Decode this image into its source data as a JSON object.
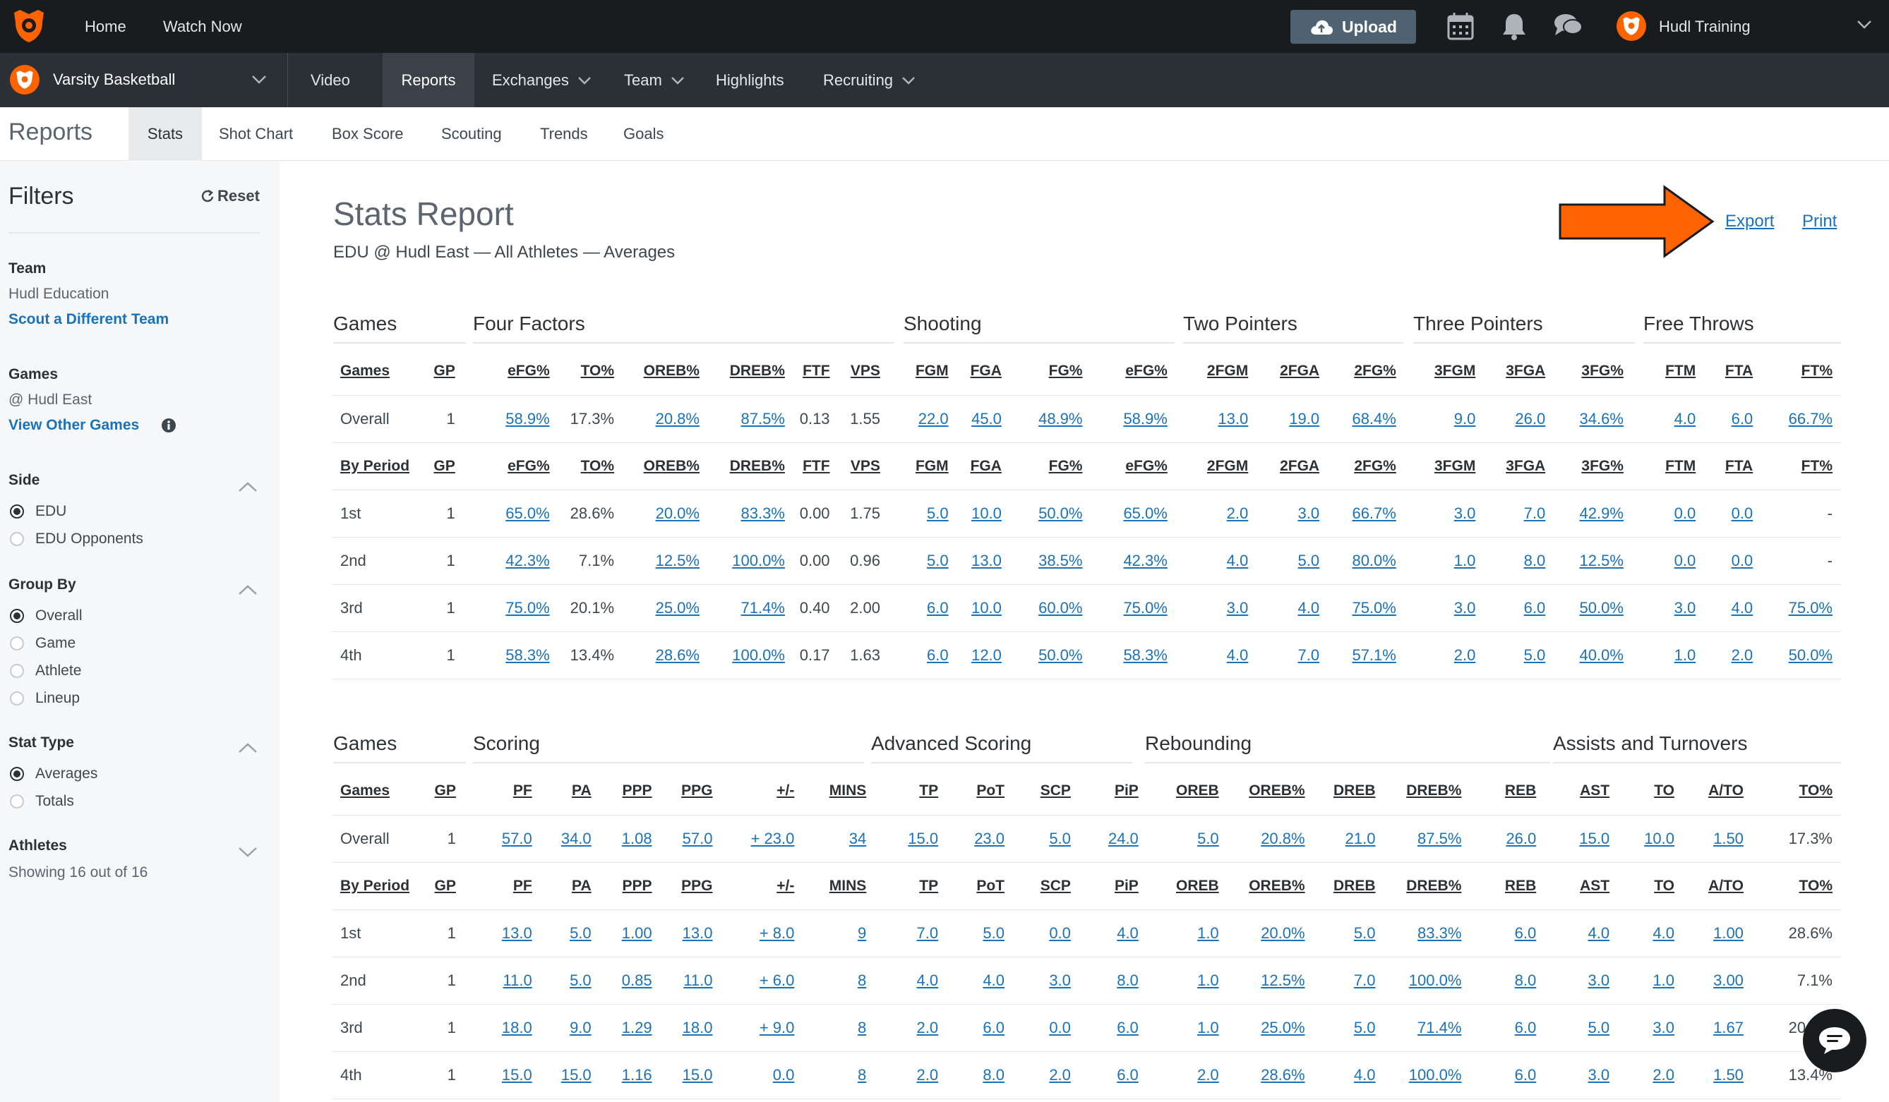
{
  "topbar": {
    "home": "Home",
    "watch_now": "Watch Now",
    "upload": "Upload",
    "user": "Hudl Training"
  },
  "navbar": {
    "team": "Varsity Basketball",
    "items": [
      "Video",
      "Reports",
      "Exchanges",
      "Team",
      "Highlights",
      "Recruiting"
    ]
  },
  "tabs": {
    "title": "Reports",
    "items": [
      "Stats",
      "Shot Chart",
      "Box Score",
      "Scouting",
      "Trends",
      "Goals"
    ]
  },
  "sidebar": {
    "title": "Filters",
    "reset": "Reset",
    "team_label": "Team",
    "team_value": "Hudl Education",
    "team_link": "Scout a Different Team",
    "games_label": "Games",
    "games_value": "@ Hudl East",
    "games_link": "View Other Games",
    "side_label": "Side",
    "side_options": [
      "EDU",
      "EDU Opponents"
    ],
    "groupby_label": "Group By",
    "groupby_options": [
      "Overall",
      "Game",
      "Athlete",
      "Lineup"
    ],
    "stattype_label": "Stat Type",
    "stattype_options": [
      "Averages",
      "Totals"
    ],
    "athletes_label": "Athletes",
    "athletes_value": "Showing 16 out of 16"
  },
  "report": {
    "title": "Stats Report",
    "subtitle": "EDU @ Hudl East — All Athletes — Averages",
    "export": "Export",
    "print": "Print"
  },
  "colors": {
    "accent": "#ff6300",
    "link": "#1b72b8",
    "topbar": "#191c1f"
  },
  "table1": {
    "groups": [
      "Games",
      "Four Factors",
      "Shooting",
      "Two Pointers",
      "Three Pointers",
      "Free Throws"
    ],
    "head_overall": [
      "Games",
      "GP",
      "eFG%",
      "TO%",
      "OREB%",
      "DREB%",
      "FTF",
      "VPS",
      "FGM",
      "FGA",
      "FG%",
      "eFG%",
      "2FGM",
      "2FGA",
      "2FG%",
      "3FGM",
      "3FGA",
      "3FG%",
      "FTM",
      "FTA",
      "FT%"
    ],
    "head_period": [
      "By Period",
      "GP",
      "eFG%",
      "TO%",
      "OREB%",
      "DREB%",
      "FTF",
      "VPS",
      "FGM",
      "FGA",
      "FG%",
      "eFG%",
      "2FGM",
      "2FGA",
      "2FG%",
      "3FGM",
      "3FGA",
      "3FG%",
      "FTM",
      "FTA",
      "FT%"
    ],
    "rows": [
      [
        "Overall",
        "1",
        "58.9%",
        "17.3%",
        "20.8%",
        "87.5%",
        "0.13",
        "1.55",
        "22.0",
        "45.0",
        "48.9%",
        "58.9%",
        "13.0",
        "19.0",
        "68.4%",
        "9.0",
        "26.0",
        "34.6%",
        "4.0",
        "6.0",
        "66.7%"
      ],
      [
        "1st",
        "1",
        "65.0%",
        "28.6%",
        "20.0%",
        "83.3%",
        "0.00",
        "1.75",
        "5.0",
        "10.0",
        "50.0%",
        "65.0%",
        "2.0",
        "3.0",
        "66.7%",
        "3.0",
        "7.0",
        "42.9%",
        "0.0",
        "0.0",
        "-"
      ],
      [
        "2nd",
        "1",
        "42.3%",
        "7.1%",
        "12.5%",
        "100.0%",
        "0.00",
        "0.96",
        "5.0",
        "13.0",
        "38.5%",
        "42.3%",
        "4.0",
        "5.0",
        "80.0%",
        "1.0",
        "8.0",
        "12.5%",
        "0.0",
        "0.0",
        "-"
      ],
      [
        "3rd",
        "1",
        "75.0%",
        "20.1%",
        "25.0%",
        "71.4%",
        "0.40",
        "2.00",
        "6.0",
        "10.0",
        "60.0%",
        "75.0%",
        "3.0",
        "4.0",
        "75.0%",
        "3.0",
        "6.0",
        "50.0%",
        "3.0",
        "4.0",
        "75.0%"
      ],
      [
        "4th",
        "1",
        "58.3%",
        "13.4%",
        "28.6%",
        "100.0%",
        "0.17",
        "1.63",
        "6.0",
        "12.0",
        "50.0%",
        "58.3%",
        "4.0",
        "7.0",
        "57.1%",
        "2.0",
        "5.0",
        "40.0%",
        "1.0",
        "2.0",
        "50.0%"
      ]
    ]
  },
  "table2": {
    "groups": [
      "Games",
      "Scoring",
      "Advanced Scoring",
      "Rebounding",
      "Assists and Turnovers"
    ],
    "head_overall": [
      "Games",
      "GP",
      "PF",
      "PA",
      "PPP",
      "PPG",
      "+/-",
      "MINS",
      "TP",
      "PoT",
      "SCP",
      "PiP",
      "OREB",
      "OREB%",
      "DREB",
      "DREB%",
      "REB",
      "AST",
      "TO",
      "A/TO",
      "TO%"
    ],
    "head_period": [
      "By Period",
      "GP",
      "PF",
      "PA",
      "PPP",
      "PPG",
      "+/-",
      "MINS",
      "TP",
      "PoT",
      "SCP",
      "PiP",
      "OREB",
      "OREB%",
      "DREB",
      "DREB%",
      "REB",
      "AST",
      "TO",
      "A/TO",
      "TO%"
    ],
    "rows": [
      [
        "Overall",
        "1",
        "57.0",
        "34.0",
        "1.08",
        "57.0",
        "+ 23.0",
        "34",
        "15.0",
        "23.0",
        "5.0",
        "24.0",
        "5.0",
        "20.8%",
        "21.0",
        "87.5%",
        "26.0",
        "15.0",
        "10.0",
        "1.50",
        "17.3%"
      ],
      [
        "1st",
        "1",
        "13.0",
        "5.0",
        "1.00",
        "13.0",
        "+ 8.0",
        "9",
        "7.0",
        "5.0",
        "0.0",
        "4.0",
        "1.0",
        "20.0%",
        "5.0",
        "83.3%",
        "6.0",
        "4.0",
        "4.0",
        "1.00",
        "28.6%"
      ],
      [
        "2nd",
        "1",
        "11.0",
        "5.0",
        "0.85",
        "11.0",
        "+ 6.0",
        "8",
        "4.0",
        "4.0",
        "3.0",
        "8.0",
        "1.0",
        "12.5%",
        "7.0",
        "100.0%",
        "8.0",
        "3.0",
        "1.0",
        "3.00",
        "7.1%"
      ],
      [
        "3rd",
        "1",
        "18.0",
        "9.0",
        "1.29",
        "18.0",
        "+ 9.0",
        "8",
        "2.0",
        "6.0",
        "0.0",
        "6.0",
        "1.0",
        "25.0%",
        "5.0",
        "71.4%",
        "6.0",
        "5.0",
        "3.0",
        "1.67",
        "20.1%"
      ],
      [
        "4th",
        "1",
        "15.0",
        "15.0",
        "1.16",
        "15.0",
        "0.0",
        "8",
        "2.0",
        "8.0",
        "2.0",
        "6.0",
        "2.0",
        "28.6%",
        "4.0",
        "100.0%",
        "6.0",
        "3.0",
        "2.0",
        "1.50",
        "13.4%"
      ]
    ]
  }
}
